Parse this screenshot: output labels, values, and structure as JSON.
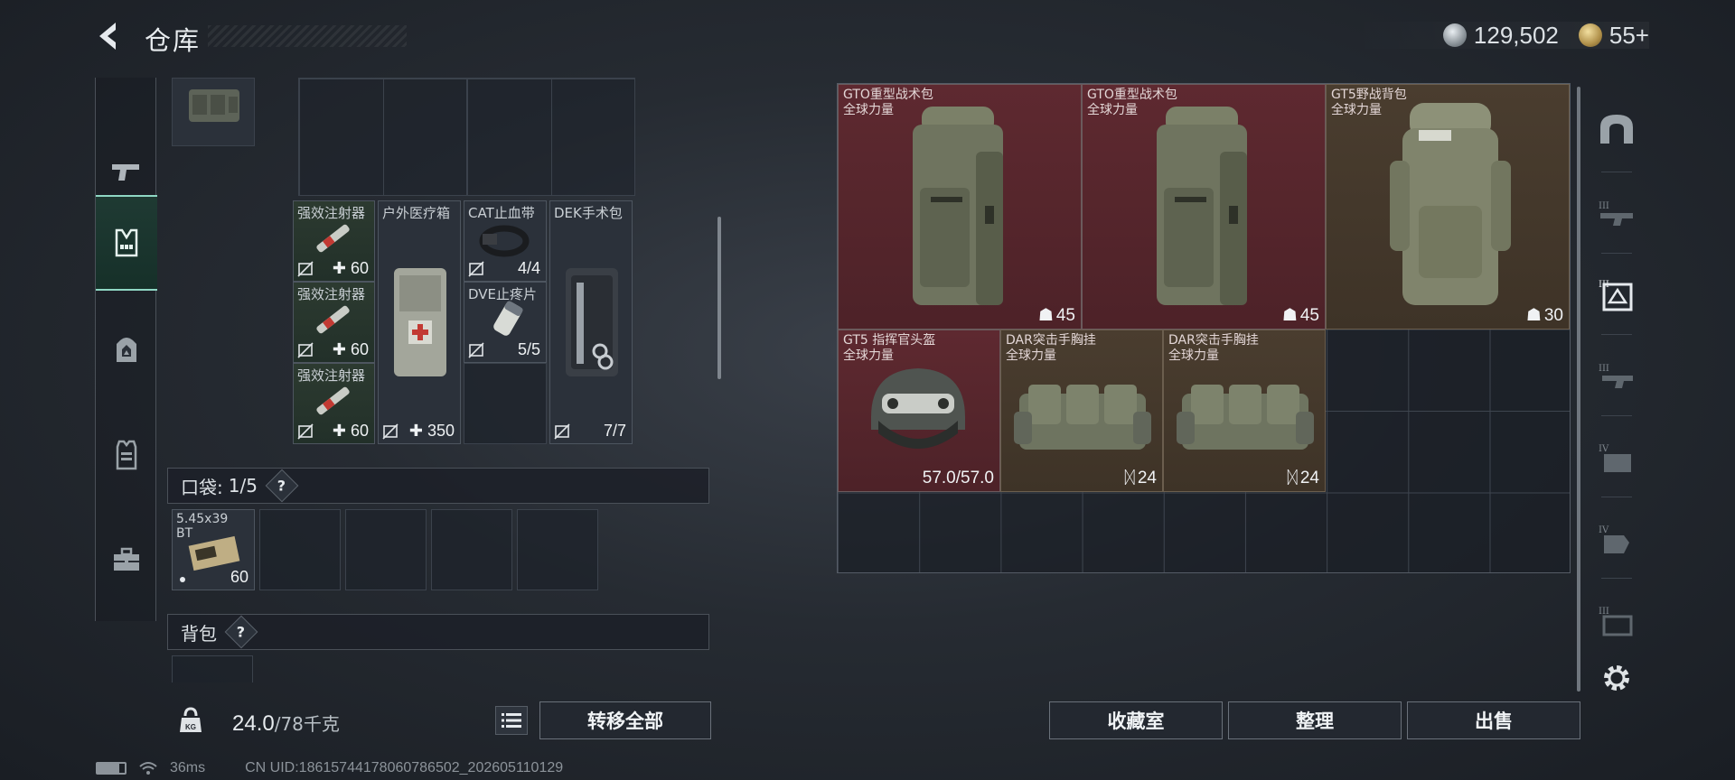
{
  "header": {
    "title": "仓库"
  },
  "currency": {
    "silver": "129,502",
    "gold": "55+"
  },
  "left_tabs": [
    "weapon",
    "chest-rig",
    "backpack",
    "armor",
    "toolbox"
  ],
  "containers": {
    "medical": [
      {
        "name": "强效注射器",
        "qty": "60"
      },
      {
        "name": "强效注射器",
        "qty": "60"
      },
      {
        "name": "强效注射器",
        "qty": "60"
      },
      {
        "name": "户外医疗箱",
        "qty": "350"
      },
      {
        "name": "CAT止血带",
        "qty": "4/4"
      },
      {
        "name": "DVE止疼片",
        "qty": "5/5"
      },
      {
        "name": "DEK手术包",
        "qty": "7/7"
      }
    ]
  },
  "pocket": {
    "label": "口袋:",
    "count": "1/5",
    "help": "?",
    "item": {
      "name": "5.45x39",
      "sub": "BT",
      "qty": "60"
    }
  },
  "backpack": {
    "label": "背包",
    "help": "?"
  },
  "weight": {
    "current": "24.0",
    "max": "/78千克"
  },
  "buttons": {
    "transfer_all": "转移全部",
    "vault": "收藏室",
    "sort": "整理",
    "sell": "出售"
  },
  "stash": [
    {
      "name": "GTO重型战术包",
      "sub": "全球力量",
      "qty": "45",
      "color": "red"
    },
    {
      "name": "GTO重型战术包",
      "sub": "全球力量",
      "qty": "45",
      "color": "red"
    },
    {
      "name": "GT5野战背包",
      "sub": "全球力量",
      "qty": "30",
      "color": "brown"
    },
    {
      "name": "GT5 指挥官头盔",
      "sub": "全球力量",
      "qty": "57.0/57.0",
      "color": "red"
    },
    {
      "name": "DAR突击手胸挂",
      "sub": "全球力量",
      "qty": "24",
      "color": "brown"
    },
    {
      "name": "DAR突击手胸挂",
      "sub": "全球力量",
      "qty": "24",
      "color": "brown"
    }
  ],
  "status": {
    "ping": "36ms",
    "uid": "CN UID:18615744178060786502_202605110129"
  },
  "colors": {
    "accent": "#8fd7c4",
    "red_item": "#5e2930",
    "brown_item": "#4a3d2f"
  }
}
